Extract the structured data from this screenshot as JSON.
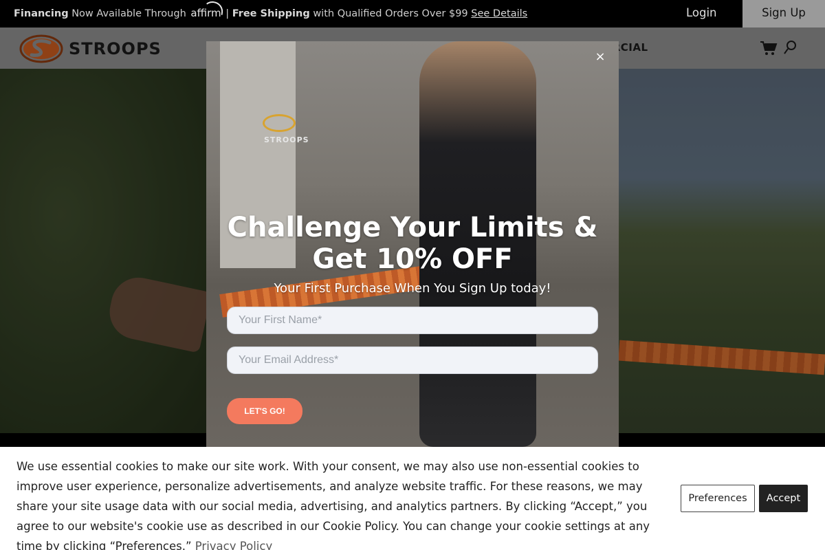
{
  "promo": {
    "financing": "Financing",
    "financing_rest": "Now Available Through",
    "affirm_brand": "affirm",
    "separator": "|",
    "free_shipping": "Free Shipping",
    "shipping_rest": "with Qualified Orders Over $99",
    "see_details": "See Details",
    "login": "Login",
    "signup": "Sign Up"
  },
  "header": {
    "brand": "STROOPS",
    "nav_visible_fragment": "ERCIAL",
    "icons": [
      "cart-icon",
      "search-icon"
    ]
  },
  "modal": {
    "close": "×",
    "title_line1": "Challenge Your Limits &",
    "title_line2": "Get 10% OFF",
    "subtitle": "Your First Purchase When You Sign Up today!",
    "first_name_placeholder": "Your First Name*",
    "email_placeholder": "Your Email Address*",
    "cta": "LET'S GO!",
    "shirt_brand": "STROOPS"
  },
  "cookie": {
    "text": "We use essential cookies to make our site work. With your consent, we may also use non-essential cookies to improve user experience, personalize advertisements, and analyze website traffic. For these reasons, we may share your site usage data with our social media, advertising, and analytics partners. By clicking “Accept,” you agree to our website's cookie use as described in our Cookie Policy. You can change your cookie settings at any time by clicking “Preferences.”",
    "privacy_link": "Privacy Policy",
    "preferences": "Preferences",
    "accept": "Accept"
  },
  "colors": {
    "brand_orange": "#d86a2c",
    "cta": "#f47a5e",
    "accept_bg": "#222222"
  }
}
